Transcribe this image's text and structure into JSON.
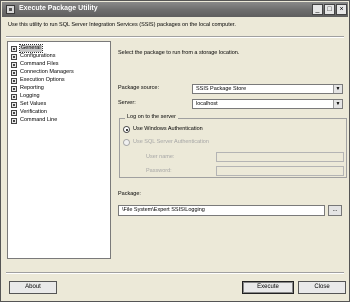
{
  "window": {
    "title": "Execute Package Utility",
    "controls": {
      "minimize": "_",
      "maximize": "□",
      "close": "×"
    }
  },
  "intro_text": "Use this utility to run SQL Server Integration Services (SSIS) packages on the local computer.",
  "nav": {
    "items": [
      {
        "label": "General",
        "selected": true
      },
      {
        "label": "Configurations"
      },
      {
        "label": "Command Files"
      },
      {
        "label": "Connection Managers"
      },
      {
        "label": "Execution Options"
      },
      {
        "label": "Reporting"
      },
      {
        "label": "Logging"
      },
      {
        "label": "Set Values"
      },
      {
        "label": "Verification"
      },
      {
        "label": "Command Line"
      }
    ]
  },
  "general": {
    "header": "Select the package to run from a storage location.",
    "package_source": {
      "label": "Package source:",
      "value": "SSIS Package Store"
    },
    "server": {
      "label": "Server:",
      "value": "localhost"
    },
    "logon": {
      "title": "Log on to the server",
      "windows_auth": "Use Windows Authentication",
      "sql_auth": "Use SQL Server Authentication",
      "user_name_label": "User name:",
      "password_label": "Password:",
      "user_name_value": "",
      "password_value": ""
    },
    "package": {
      "label": "Package:",
      "value": "\\File System\\Expert SSIS\\Logging",
      "browse_label": "..."
    }
  },
  "footer": {
    "about": "About",
    "execute": "Execute",
    "close": "Close"
  }
}
